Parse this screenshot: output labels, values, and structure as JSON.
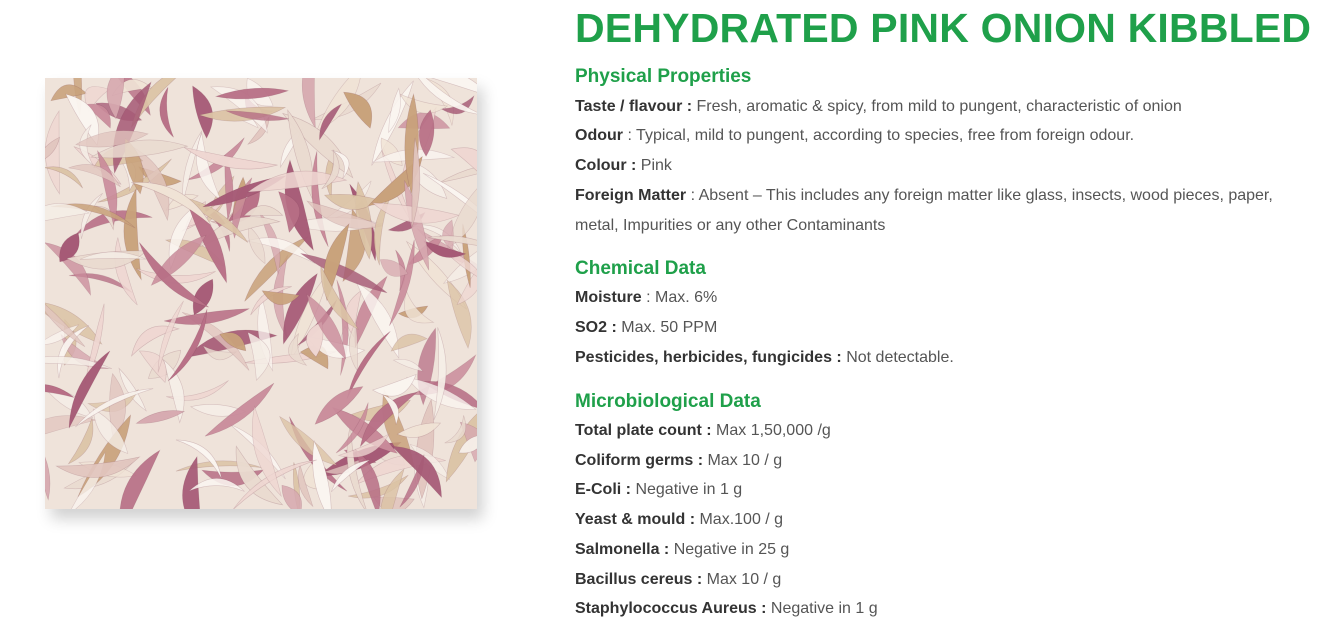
{
  "product": {
    "title": "DEHYDRATED PINK ONION KIBBLED"
  },
  "physical": {
    "heading": "Physical Properties",
    "rows": [
      {
        "label": "Taste / flavour :",
        "value": " Fresh, aromatic & spicy, from mild to pungent, characteristic of onion"
      },
      {
        "label": "Odour",
        "value": " : Typical, mild to pungent, according to species, free from foreign odour."
      },
      {
        "label": "Colour :",
        "value": " Pink"
      },
      {
        "label": "Foreign Matter",
        "value": " : Absent – This includes any foreign matter like glass, insects, wood pieces, paper, metal, Impurities or any other Contaminants"
      }
    ]
  },
  "chemical": {
    "heading": "Chemical Data",
    "rows": [
      {
        "label": "Moisture",
        "value": " : Max. 6%"
      },
      {
        "label": "SO2 :",
        "value": " Max. 50 PPM"
      },
      {
        "label": "Pesticides, herbicides, fungicides :",
        "value": " Not detectable."
      }
    ]
  },
  "micro": {
    "heading": "Microbiological Data",
    "rows": [
      {
        "label": "Total plate count :",
        "value": " Max 1,50,000 /g"
      },
      {
        "label": "Coliform germs :",
        "value": " Max 10 / g"
      },
      {
        "label": "E-Coli :",
        "value": " Negative in 1 g"
      },
      {
        "label": "Yeast & mould :",
        "value": " Max.100 / g"
      },
      {
        "label": "Salmonella :",
        "value": " Negative in 25 g"
      },
      {
        "label": "Bacillus cereus :",
        "value": " Max 10 / g"
      },
      {
        "label": "Staphylococcus Aureus :",
        "value": " Negative in 1 g"
      }
    ]
  },
  "colors": {
    "heading_green": "#1fa04a",
    "body_text": "#555555",
    "label_text": "#333333"
  }
}
